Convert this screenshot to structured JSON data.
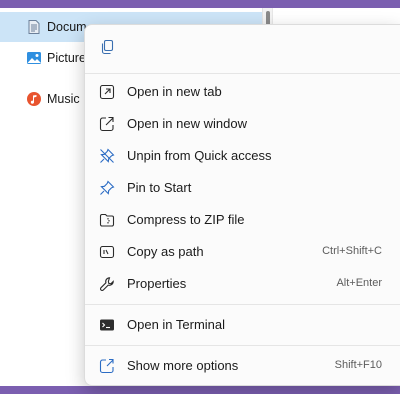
{
  "nav": {
    "items": [
      {
        "label": "Docum",
        "icon": "documents-folder-icon",
        "selected": true
      },
      {
        "label": "Picture",
        "icon": "pictures-folder-icon",
        "selected": false
      },
      {
        "label": "Music",
        "icon": "music-folder-icon",
        "selected": false
      }
    ]
  },
  "menu": {
    "quick_actions": [
      {
        "icon": "copy-icon"
      }
    ],
    "items": [
      {
        "label": "Open in new tab",
        "icon": "open-new-tab-icon",
        "shortcut": ""
      },
      {
        "label": "Open in new window",
        "icon": "open-new-window-icon",
        "shortcut": ""
      },
      {
        "label": "Unpin from Quick access",
        "icon": "unpin-icon",
        "shortcut": ""
      },
      {
        "label": "Pin to Start",
        "icon": "pin-icon",
        "shortcut": ""
      },
      {
        "label": "Compress to ZIP file",
        "icon": "zip-folder-icon",
        "shortcut": ""
      },
      {
        "label": "Copy as path",
        "icon": "copy-path-icon",
        "shortcut": "Ctrl+Shift+C"
      },
      {
        "label": "Properties",
        "icon": "wrench-icon",
        "shortcut": "Alt+Enter"
      },
      {
        "label": "Open in Terminal",
        "icon": "terminal-icon",
        "shortcut": ""
      },
      {
        "label": "Show more options",
        "icon": "show-more-options-icon",
        "shortcut": "Shift+F10"
      }
    ]
  },
  "colors": {
    "accent": "#005fb8",
    "selection": "#cce4f7",
    "desktop": "#7b5fb0"
  }
}
